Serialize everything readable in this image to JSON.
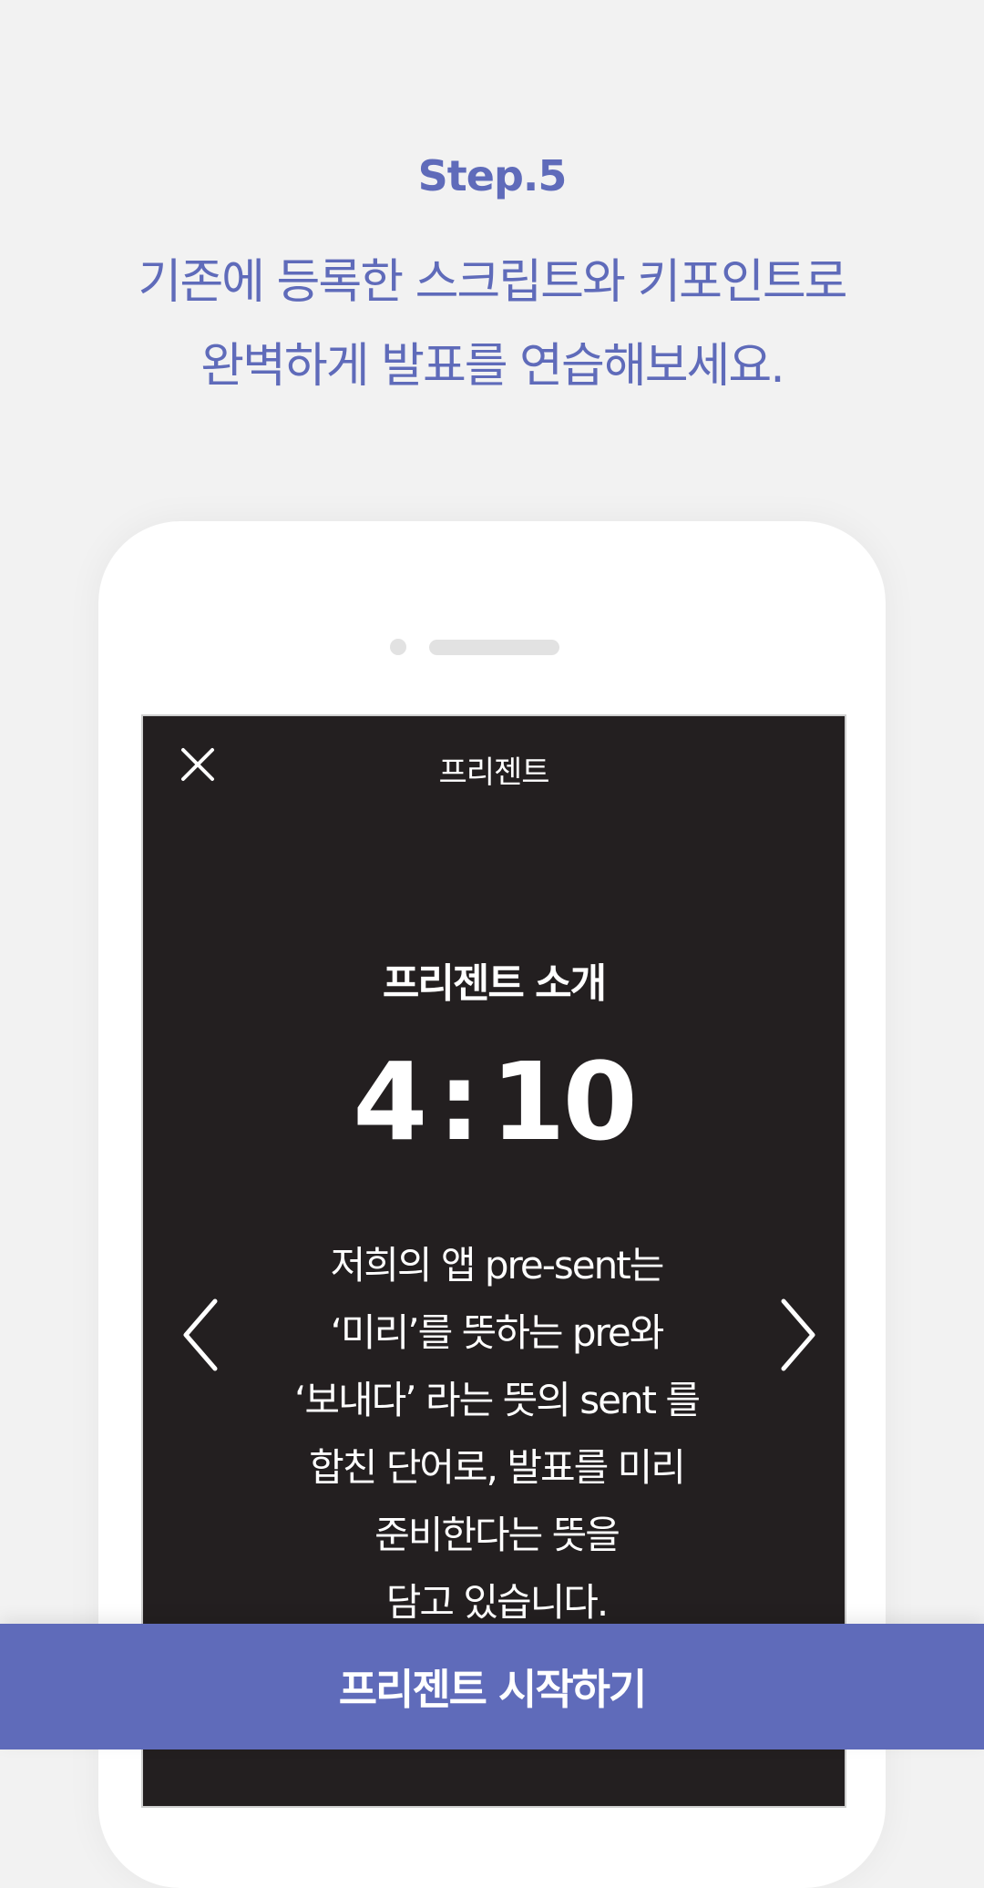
{
  "intro": {
    "step": "Step.5",
    "headline_line1": "기존에 등록한 스크립트와 키포인트로",
    "headline_line2": "완벽하게 발표를 연습해보세요."
  },
  "phone_screen": {
    "title": "프리젠트",
    "close_icon": "close-icon",
    "slide_title": "프리젠트 소개",
    "timer": {
      "minutes": "4",
      "separator": ":",
      "seconds": "10"
    },
    "script_lines": [
      "저희의 앱 pre-sent는",
      "‘미리’를 뜻하는 pre와",
      "‘보내다’ 라는 뜻의 sent 를",
      "합친 단어로, 발표를 미리",
      "준비한다는 뜻을",
      "담고 있습니다."
    ],
    "prev_icon": "chevron-left-icon",
    "next_icon": "chevron-right-icon"
  },
  "cta": {
    "label": "프리젠트 시작하기"
  },
  "colors": {
    "accent": "#5f6bba",
    "background": "#f2f2f2",
    "screen_bg": "#231f20",
    "text_on_dark": "#ffffff"
  }
}
